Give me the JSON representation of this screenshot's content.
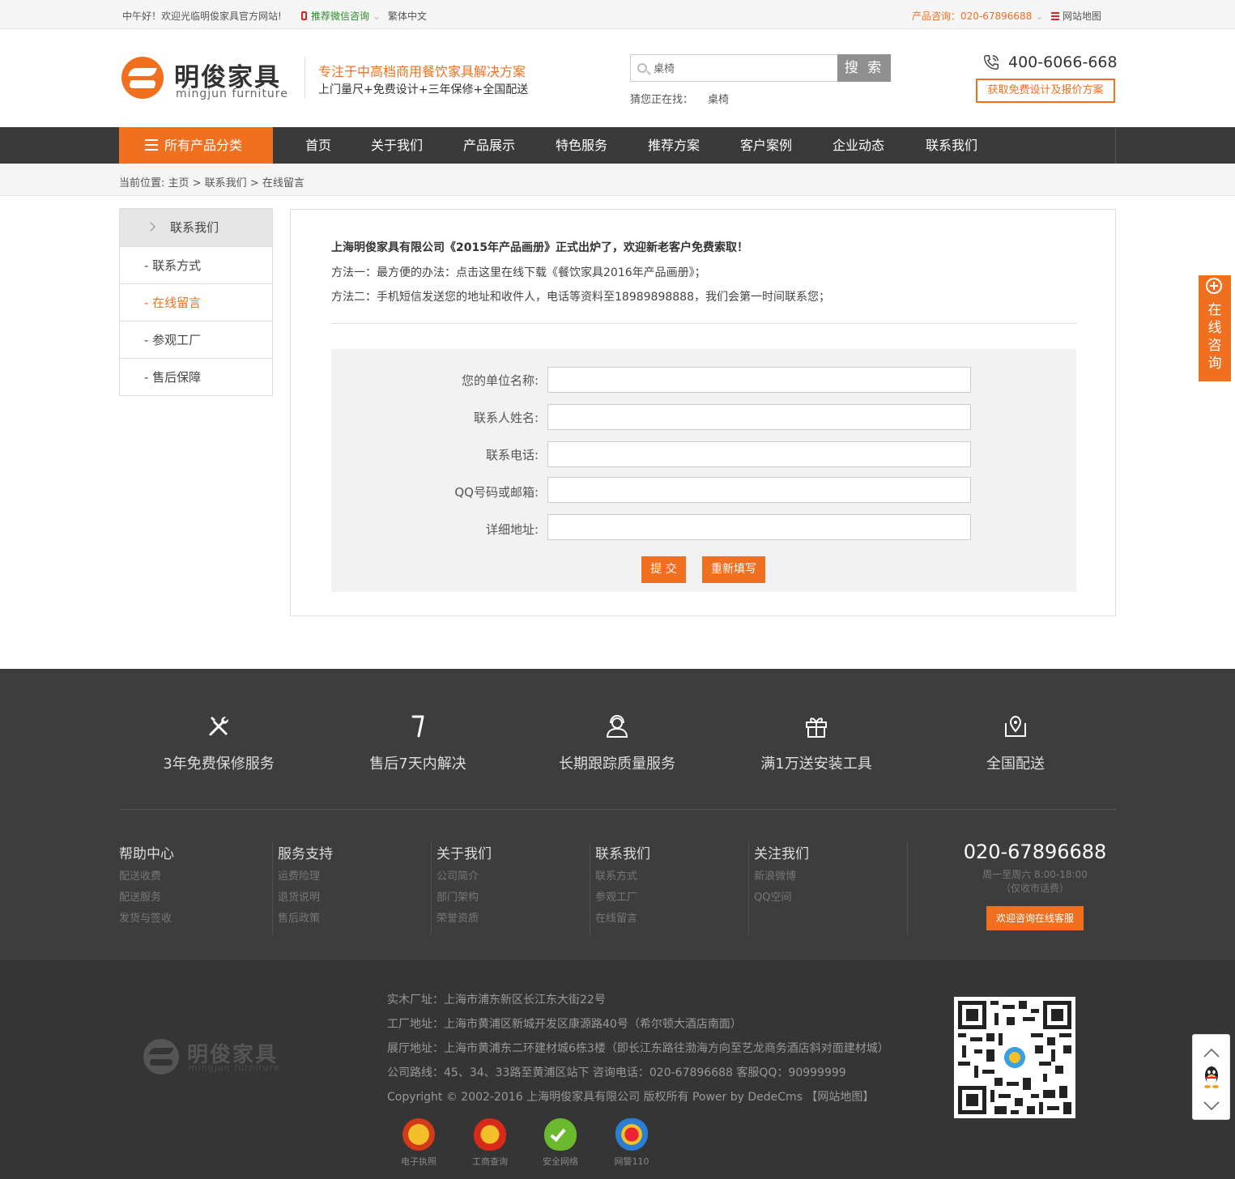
{
  "topbar": {
    "greeting": "中午好！欢迎光临明俊家具官方网站!",
    "wechat": "推荐微信咨询",
    "traditional": "繁体中文",
    "product_hotline": "产品咨询：020-67896688",
    "sitemap": "网站地图"
  },
  "header": {
    "logo_cn": "明俊家具",
    "logo_en": "mingjun furniture",
    "slogan": "专注于中高档商用餐饮家具解决方案",
    "subslogan": "上门量尺+免费设计+三年保修+全国配送",
    "search_value": "桌椅",
    "search_button": "搜 索",
    "hot_label": "猜您正在找：",
    "hot_keyword": "桌椅",
    "hotline": "400-6066-668",
    "quote_button": "获取免费设计及报价方案"
  },
  "nav": {
    "all_categories": "所有产品分类",
    "items": [
      "首页",
      "关于我们",
      "产品展示",
      "特色服务",
      "推荐方案",
      "客户案例",
      "企业动态",
      "联系我们"
    ]
  },
  "breadcrumb": {
    "text": "当前位置: 主页 > 联系我们 > 在线留言"
  },
  "sidebar": {
    "title": "联系我们",
    "items": [
      "- 联系方式",
      "- 在线留言",
      "- 参观工厂",
      "- 售后保障"
    ]
  },
  "content": {
    "intro_title": "上海明俊家具有限公司《2015年产品画册》正式出炉了，欢迎新老客户免费索取！",
    "method1": "方法一：最方便的办法：点击这里在线下载《餐饮家具2016年产品画册》；",
    "method2": "方法二：手机短信发送您的地址和收件人，电话等资料至18989898888，我们会第一时间联系您；",
    "form": {
      "company_label": "您的单位名称:",
      "name_label": "联系人姓名:",
      "phone_label": "联系电话:",
      "qq_label": "QQ号码或邮箱:",
      "address_label": "详细地址:",
      "submit": "提 交",
      "reset": "重新填写"
    }
  },
  "float_consult": {
    "label": "在线咨询"
  },
  "footer": {
    "features": [
      "3年免费保修服务",
      "售后7天内解决",
      "长期跟踪质量服务",
      "满1万送安装工具",
      "全国配送"
    ],
    "columns": [
      {
        "title": "帮助中心",
        "links": [
          "配送收费",
          "配送服务",
          "发货与签收"
        ]
      },
      {
        "title": "服务支持",
        "links": [
          "运费险理",
          "退货说明",
          "售后政策"
        ]
      },
      {
        "title": "关于我们",
        "links": [
          "公司简介",
          "部门架构",
          "荣誉资质"
        ]
      },
      {
        "title": "联系我们",
        "links": [
          "联系方式",
          "参观工厂",
          "在线留言"
        ]
      },
      {
        "title": "关注我们",
        "links": [
          "新浪微博",
          "QQ空间"
        ]
      }
    ],
    "phone": "020-67896688",
    "hours": "周一至周六 8:00-18:00",
    "hours_note": "（仅收市话费）",
    "kf_button": "欢迎咨询在线客服",
    "logo_cn": "明俊家具",
    "logo_en": "mingjun furniture",
    "addresses": [
      "实木厂址：上海市浦东新区长江东大街22号",
      "工厂地址：上海市黄浦区新城开发区康源路40号（希尔顿大酒店南面）",
      "展厅地址：上海市黄浦东二环建材城6栋3楼（即长江东路往渤海方向至艺龙商务酒店斜对面建材城）",
      "公司路线：45、34、33路至黄浦区站下    咨询电话：020-67896688    客服QQ：90999999",
      "Copyright © 2002-2016 上海明俊家具有限公司 版权所有 Power by DedeCms    【网站地图】"
    ],
    "badges": [
      "电子执照",
      "工商查询",
      "安全网络",
      "网警110"
    ]
  }
}
